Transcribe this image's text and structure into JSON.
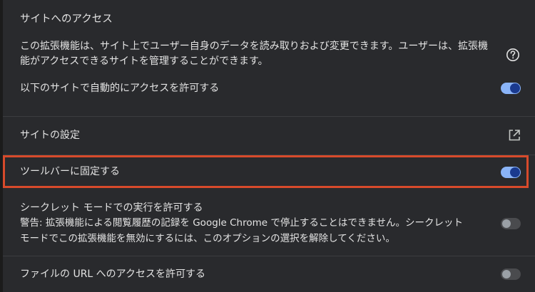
{
  "site_access": {
    "heading": "サイトへのアクセス",
    "description_line1": "この拡張機能は、サイト上でユーザー自身のデータを読み取りおよび変更できます。ユーザーは、拡張機",
    "description_line2": "能がアクセスできるサイトを管理することができます。",
    "auto_allow_label": "以下のサイトで自動的にアクセスを許可する",
    "auto_allow_state": "on"
  },
  "site_settings": {
    "label": "サイトの設定"
  },
  "pin_toolbar": {
    "label": "ツールバーに固定する",
    "state": "on"
  },
  "incognito": {
    "label": "シークレット モードでの実行を許可する",
    "warning_line1": "警告: 拡張機能による閲覧履歴の記録を Google Chrome で停止することはできません。シークレット",
    "warning_line2": "モードでこの拡張機能を無効にするには、このオプションの選択を解除してください。",
    "state": "off"
  },
  "file_urls": {
    "label": "ファイルの URL へのアクセスを許可する",
    "state": "off"
  },
  "colors": {
    "background": "#292a2d",
    "toggle_on": "#8ab4f8",
    "highlight": "#d84a2b"
  }
}
